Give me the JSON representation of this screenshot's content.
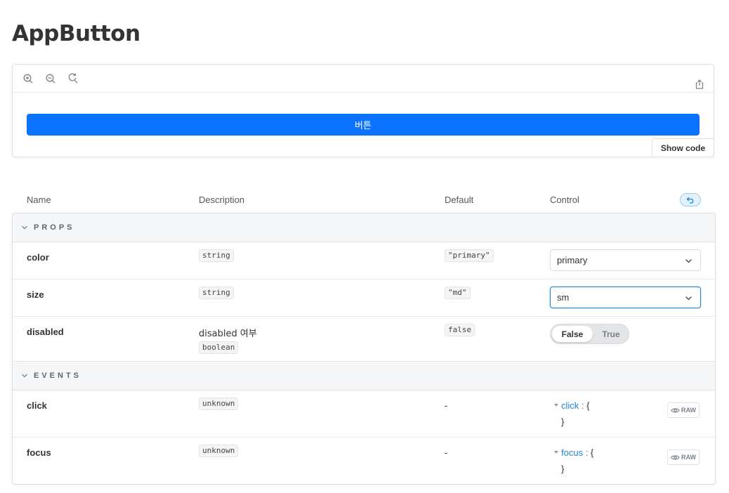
{
  "page": {
    "title": "AppButton"
  },
  "preview": {
    "toolbar": {
      "zoom_in": "zoom-in-icon",
      "zoom_out": "zoom-out-icon",
      "reset_zoom": "reset-zoom-icon",
      "share": "share-icon"
    },
    "button_label": "버튼",
    "show_code_label": "Show code"
  },
  "args_table": {
    "headers": {
      "name": "Name",
      "description": "Description",
      "default": "Default",
      "control": "Control"
    },
    "reset_icon": "undo-icon",
    "sections": {
      "props": "PROPS",
      "events": "EVENTS"
    },
    "props": [
      {
        "name": "color",
        "type": "string",
        "default": "\"primary\"",
        "control_value": "primary"
      },
      {
        "name": "size",
        "type": "string",
        "default": "\"md\"",
        "control_value": "sm"
      },
      {
        "name": "disabled",
        "description": "disabled 여부",
        "type": "boolean",
        "default": "false",
        "toggle_options": [
          "False",
          "True"
        ],
        "toggle_selected": "False"
      }
    ],
    "events": [
      {
        "name": "click",
        "type": "unknown",
        "default": "-",
        "key": "click",
        "colon": " : ",
        "open": "{",
        "close": "}",
        "raw_label": "RAW"
      },
      {
        "name": "focus",
        "type": "unknown",
        "default": "-",
        "key": "focus",
        "colon": " : ",
        "open": "{",
        "close": "}",
        "raw_label": "RAW"
      }
    ]
  },
  "colors": {
    "primary_button": "#0a72ff",
    "link": "#1c86d9",
    "focus_border": "#1c86d9"
  }
}
